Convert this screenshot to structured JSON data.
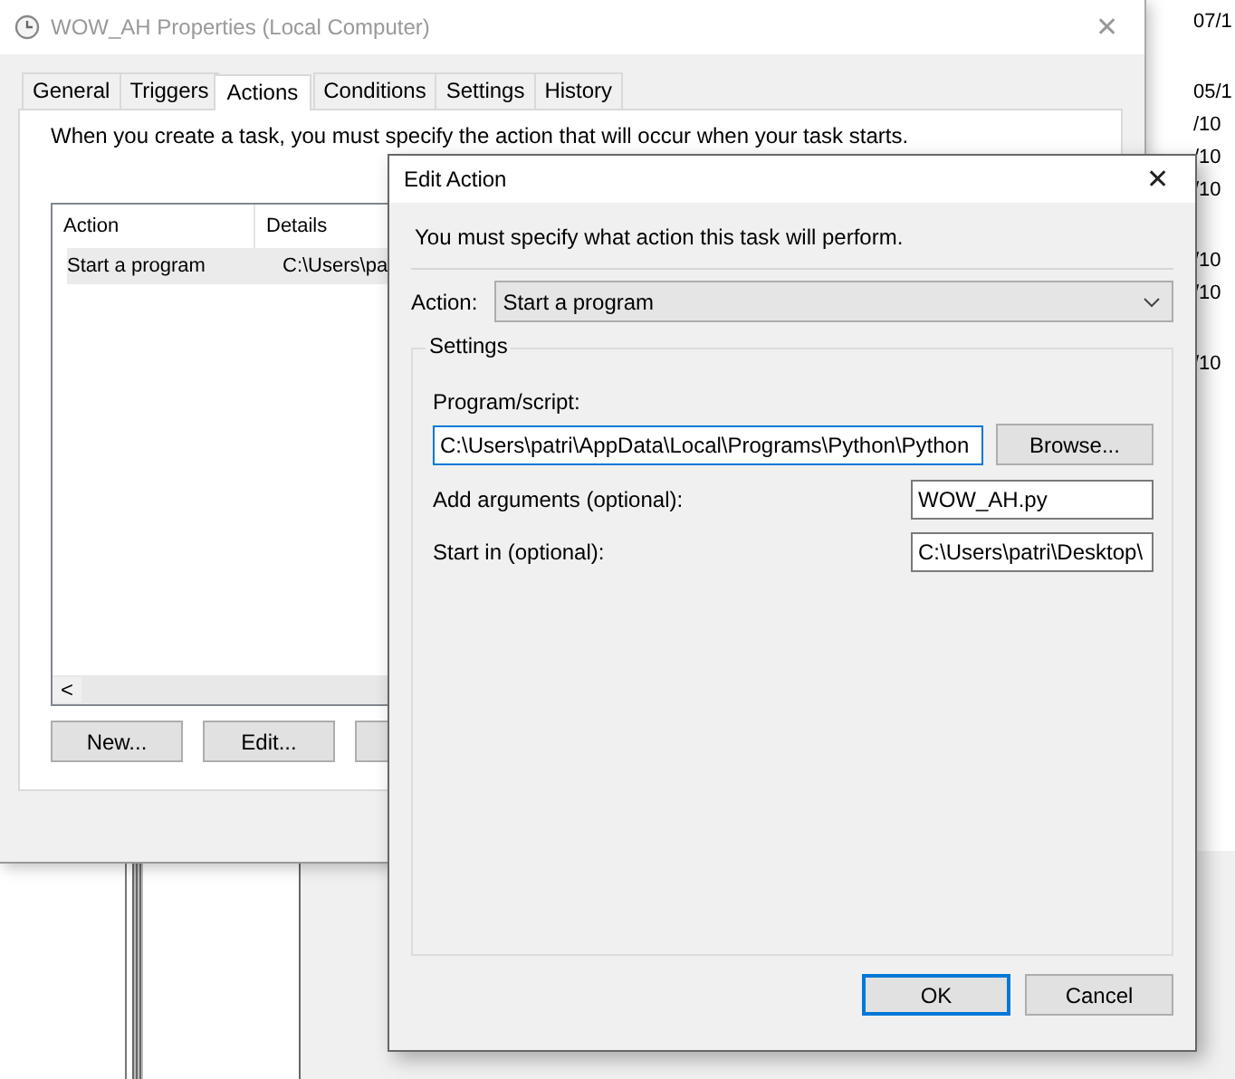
{
  "background_app": {
    "date_groups": [
      [
        "07/1"
      ],
      [
        "05/1",
        "/10",
        "/10",
        "/10"
      ],
      [
        "/10",
        "/10"
      ],
      [
        "/10"
      ]
    ]
  },
  "properties_window": {
    "title": "WOW_AH Properties (Local Computer)",
    "close": "✕",
    "tabs": [
      {
        "label": "General",
        "selected": false
      },
      {
        "label": "Triggers",
        "selected": false
      },
      {
        "label": "Actions",
        "selected": true
      },
      {
        "label": "Conditions",
        "selected": false
      },
      {
        "label": "Settings",
        "selected": false
      },
      {
        "label": "History",
        "selected": false
      }
    ],
    "description": "When you create a task, you must specify the action that will occur when your task starts.",
    "actions_table": {
      "columns": [
        "Action",
        "Details"
      ],
      "rows": [
        {
          "cells": [
            "Start a program",
            "C:\\Users\\pa"
          ],
          "selected": true
        }
      ],
      "scroll_left": "<"
    },
    "buttons": [
      "New...",
      "Edit..."
    ]
  },
  "edit_action_dialog": {
    "title": "Edit Action",
    "close": "✕",
    "instruction": "You must specify what action this task will perform.",
    "action_label": "Action:",
    "action_value": "Start a program",
    "settings_title": "Settings",
    "program_label": "Program/script:",
    "program_value": "C:\\Users\\patri\\AppData\\Local\\Programs\\Python\\Python",
    "program_focused": true,
    "browse_button": "Browse...",
    "fields": [
      {
        "label": "Add arguments (optional):",
        "value": "WOW_AH.py"
      },
      {
        "label": "Start in (optional):",
        "value": "C:\\Users\\patri\\Desktop\\"
      }
    ],
    "buttons": [
      {
        "label": "OK",
        "default": true
      },
      {
        "label": "Cancel",
        "default": false
      }
    ]
  }
}
